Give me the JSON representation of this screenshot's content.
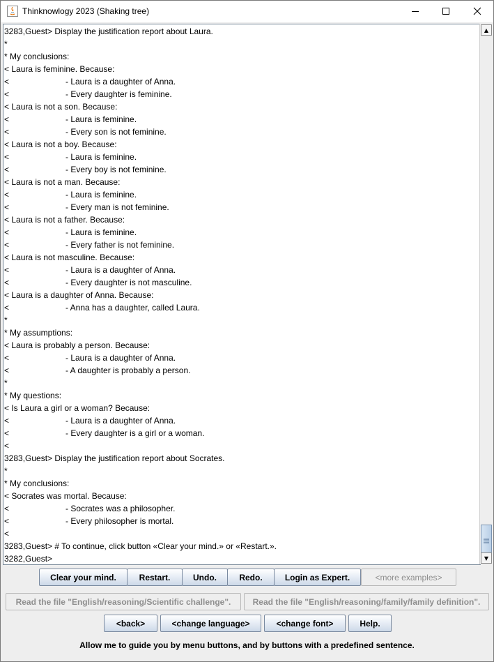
{
  "window": {
    "title": "Thinknowlogy 2023 (Shaking tree)"
  },
  "output_lines": [
    {
      "prefix": "3283,Guest> Display the justification report about Laura.",
      "indent": ""
    },
    {
      "prefix": "*",
      "indent": ""
    },
    {
      "prefix": "* My conclusions:",
      "indent": ""
    },
    {
      "prefix": "< Laura is feminine. Because:",
      "indent": ""
    },
    {
      "prefix": "<",
      "indent": "- Laura is a daughter of Anna."
    },
    {
      "prefix": "<",
      "indent": "- Every daughter is feminine."
    },
    {
      "prefix": "< Laura is not a son. Because:",
      "indent": ""
    },
    {
      "prefix": "<",
      "indent": "- Laura is feminine."
    },
    {
      "prefix": "<",
      "indent": "- Every son is not feminine."
    },
    {
      "prefix": "< Laura is not a boy. Because:",
      "indent": ""
    },
    {
      "prefix": "<",
      "indent": "- Laura is feminine."
    },
    {
      "prefix": "<",
      "indent": "- Every boy is not feminine."
    },
    {
      "prefix": "< Laura is not a man. Because:",
      "indent": ""
    },
    {
      "prefix": "<",
      "indent": "- Laura is feminine."
    },
    {
      "prefix": "<",
      "indent": "- Every man is not feminine."
    },
    {
      "prefix": "< Laura is not a father. Because:",
      "indent": ""
    },
    {
      "prefix": "<",
      "indent": "- Laura is feminine."
    },
    {
      "prefix": "<",
      "indent": "- Every father is not feminine."
    },
    {
      "prefix": "< Laura is not masculine. Because:",
      "indent": ""
    },
    {
      "prefix": "<",
      "indent": "- Laura is a daughter of Anna."
    },
    {
      "prefix": "<",
      "indent": "- Every daughter is not masculine."
    },
    {
      "prefix": "< Laura is a daughter of Anna. Because:",
      "indent": ""
    },
    {
      "prefix": "<",
      "indent": "- Anna has a daughter, called Laura."
    },
    {
      "prefix": "*",
      "indent": ""
    },
    {
      "prefix": "* My assumptions:",
      "indent": ""
    },
    {
      "prefix": "< Laura is probably a person. Because:",
      "indent": ""
    },
    {
      "prefix": "<",
      "indent": "- Laura is a daughter of Anna."
    },
    {
      "prefix": "<",
      "indent": "- A daughter is probably a person."
    },
    {
      "prefix": "*",
      "indent": ""
    },
    {
      "prefix": "* My questions:",
      "indent": ""
    },
    {
      "prefix": "< Is Laura a girl or a woman? Because:",
      "indent": ""
    },
    {
      "prefix": "<",
      "indent": "- Laura is a daughter of Anna."
    },
    {
      "prefix": "<",
      "indent": "- Every daughter is a girl or a woman."
    },
    {
      "prefix": "<",
      "indent": ""
    },
    {
      "prefix": "3283,Guest> Display the justification report about Socrates.",
      "indent": ""
    },
    {
      "prefix": "*",
      "indent": ""
    },
    {
      "prefix": "* My conclusions:",
      "indent": ""
    },
    {
      "prefix": "< Socrates was mortal. Because:",
      "indent": ""
    },
    {
      "prefix": "<",
      "indent": "- Socrates was a philosopher."
    },
    {
      "prefix": "<",
      "indent": "- Every philosopher is mortal."
    },
    {
      "prefix": "<",
      "indent": ""
    },
    {
      "prefix": "3283,Guest> # To continue, click button «Clear your mind.» or «Restart.».",
      "indent": ""
    },
    {
      "prefix": "3282,Guest>",
      "indent": ""
    }
  ],
  "buttons_row1": {
    "clear": "Clear your mind.",
    "restart": "Restart.",
    "undo": "Undo.",
    "redo": "Redo.",
    "login": "Login as Expert.",
    "more": "<more examples>"
  },
  "buttons_row2": {
    "scientific": "Read the file \"English/reasoning/Scientific challenge\".",
    "family": "Read the file \"English/reasoning/family/family definition\"."
  },
  "buttons_row3": {
    "back": "<back>",
    "language": "<change language>",
    "font": "<change font>",
    "help": "Help."
  },
  "status_text": "Allow me to guide you by menu buttons, and by buttons with a predefined sentence."
}
